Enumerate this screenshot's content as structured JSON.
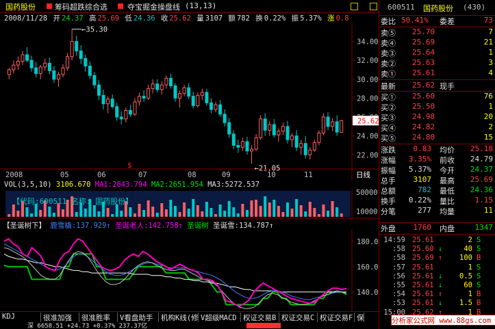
{
  "header": {
    "stock_name": "国药股份",
    "indicator1": "筹码超跌综合选",
    "indicator2": "夺宝掘金操盘线",
    "indicator2_params": "(13,13)"
  },
  "info": {
    "date": "2008/11/28",
    "open_label": "开",
    "open": "24.37",
    "high_label": "高",
    "high": "25.69",
    "low_label": "低",
    "low": "24.36",
    "close_label": "收",
    "close": "25.62",
    "vol_label": "量",
    "vol": "3107",
    "amt_label": "额",
    "amt": "782",
    "turnover_label": "换",
    "turnover": "0.22%",
    "amp_label": "振",
    "amp": "5.37%",
    "chg_label": "涨",
    "chg": "0.8"
  },
  "main_chart": {
    "y_ticks": [
      "34.00",
      "32.00",
      "30.00",
      "28.00",
      "26.00",
      "24.00",
      "22.00"
    ],
    "current_price": "25.62",
    "max_label": "35.30",
    "min_label": "21.05",
    "x_labels": [
      "2008",
      "05",
      "06",
      "07",
      "08",
      "09",
      "10",
      "11"
    ],
    "period": "日线",
    "marker": "$",
    "candles": [
      [
        30.5,
        31.2,
        30.0,
        31.0
      ],
      [
        31.0,
        32.0,
        30.6,
        31.5
      ],
      [
        31.5,
        32.4,
        31.0,
        31.9
      ],
      [
        31.9,
        33.0,
        31.5,
        32.6
      ],
      [
        32.6,
        33.4,
        31.8,
        32.0
      ],
      [
        32.0,
        32.5,
        30.8,
        31.2
      ],
      [
        31.2,
        31.8,
        30.2,
        30.6
      ],
      [
        30.6,
        31.5,
        30.0,
        31.3
      ],
      [
        31.3,
        32.2,
        30.9,
        31.7
      ],
      [
        31.7,
        32.3,
        30.5,
        30.9
      ],
      [
        30.9,
        31.4,
        29.6,
        30.0
      ],
      [
        30.0,
        30.8,
        29.2,
        30.5
      ],
      [
        30.5,
        31.6,
        30.2,
        31.2
      ],
      [
        31.2,
        32.8,
        30.9,
        32.4
      ],
      [
        32.4,
        35.3,
        32.0,
        34.0
      ],
      [
        34.0,
        34.6,
        32.5,
        33.0
      ],
      [
        33.0,
        33.6,
        31.6,
        32.2
      ],
      [
        32.2,
        32.6,
        30.8,
        31.4
      ],
      [
        31.4,
        31.9,
        30.0,
        30.4
      ],
      [
        30.4,
        30.8,
        29.0,
        29.4
      ],
      [
        29.4,
        29.9,
        27.8,
        28.3
      ],
      [
        28.3,
        28.9,
        26.8,
        27.4
      ],
      [
        27.4,
        28.2,
        26.4,
        27.9
      ],
      [
        27.9,
        28.4,
        26.9,
        27.1
      ],
      [
        27.1,
        27.5,
        25.6,
        26.0
      ],
      [
        26.0,
        26.6,
        25.2,
        25.8
      ],
      [
        25.8,
        27.0,
        25.4,
        26.7
      ],
      [
        26.7,
        27.3,
        26.0,
        26.3
      ],
      [
        26.3,
        28.0,
        26.1,
        27.6
      ],
      [
        27.6,
        28.6,
        27.2,
        28.2
      ],
      [
        28.2,
        28.8,
        27.6,
        28.0
      ],
      [
        28.0,
        29.4,
        27.8,
        29.0
      ],
      [
        29.0,
        30.0,
        28.5,
        29.5
      ],
      [
        29.5,
        30.0,
        28.6,
        28.9
      ],
      [
        28.9,
        29.8,
        28.4,
        29.4
      ],
      [
        29.4,
        30.4,
        29.0,
        30.1
      ],
      [
        30.1,
        30.6,
        29.0,
        29.3
      ],
      [
        29.3,
        29.6,
        27.6,
        28.0
      ],
      [
        28.0,
        28.8,
        27.0,
        28.5
      ],
      [
        28.5,
        29.4,
        28.2,
        29.1
      ],
      [
        29.1,
        29.6,
        27.9,
        28.2
      ],
      [
        28.2,
        28.7,
        26.9,
        27.2
      ],
      [
        27.2,
        28.6,
        27.0,
        28.3
      ],
      [
        28.3,
        29.0,
        27.8,
        28.6
      ],
      [
        28.6,
        29.0,
        27.2,
        27.5
      ],
      [
        27.5,
        28.0,
        26.4,
        26.8
      ],
      [
        26.8,
        27.6,
        26.5,
        27.3
      ],
      [
        27.3,
        27.8,
        26.0,
        26.3
      ],
      [
        26.3,
        26.8,
        25.0,
        25.4
      ],
      [
        25.4,
        25.9,
        23.8,
        24.2
      ],
      [
        24.2,
        24.6,
        22.6,
        23.0
      ],
      [
        23.0,
        23.6,
        22.2,
        22.8
      ],
      [
        22.8,
        23.8,
        22.4,
        23.4
      ],
      [
        23.4,
        23.9,
        22.0,
        22.4
      ],
      [
        22.4,
        23.0,
        21.05,
        22.6
      ],
      [
        22.6,
        24.2,
        22.4,
        23.8
      ],
      [
        23.8,
        26.2,
        23.6,
        25.8
      ],
      [
        25.8,
        26.4,
        24.0,
        24.6
      ],
      [
        24.6,
        25.6,
        24.0,
        25.2
      ],
      [
        25.2,
        25.8,
        23.8,
        24.1
      ],
      [
        24.1,
        24.8,
        23.4,
        24.5
      ],
      [
        24.5,
        25.4,
        24.1,
        25.0
      ],
      [
        25.0,
        25.6,
        23.2,
        23.6
      ],
      [
        23.6,
        24.3,
        22.8,
        24.0
      ],
      [
        24.0,
        24.6,
        22.4,
        22.8
      ],
      [
        22.8,
        23.6,
        22.0,
        23.2
      ],
      [
        23.2,
        24.0,
        21.6,
        22.0
      ],
      [
        22.0,
        22.8,
        21.5,
        22.5
      ],
      [
        22.5,
        23.6,
        22.3,
        23.3
      ],
      [
        23.3,
        24.6,
        23.0,
        24.3
      ],
      [
        24.3,
        26.4,
        24.1,
        26.0
      ],
      [
        26.0,
        26.5,
        24.6,
        25.0
      ],
      [
        25.0,
        25.9,
        24.5,
        25.5
      ],
      [
        25.5,
        26.2,
        24.0,
        24.4
      ],
      [
        24.37,
        25.69,
        24.36,
        25.62
      ]
    ]
  },
  "volume_pane": {
    "label": "VOL(3,5,10)",
    "vol": "3106.670",
    "ma1_label": "MA1:",
    "ma1": "2843.794",
    "ma2_label": "MA2:",
    "ma2": "2651.954",
    "ma3_label": "MA3:",
    "ma3": "5272.537",
    "y_ticks": [
      "50000",
      "10000"
    ],
    "code_label": "【代码:600511  名称: 国药股份】"
  },
  "indicator_pane": {
    "name": "【圣诞树下】",
    "line1_label": "鹿雪橇:",
    "line1": "137.929",
    "line2_label": "圣诞老人:",
    "line2": "142.758",
    "line3_label": "圣诞树",
    "line3": "",
    "line4_label": "圣诞雪:",
    "line4": "134.787",
    "y_ticks": [
      "180.00",
      "160.00",
      "140.00"
    ],
    "lines": {
      "snow_white": [
        170,
        168,
        167,
        166,
        166,
        165,
        164,
        163,
        163,
        162,
        161,
        160,
        160,
        159,
        158,
        157,
        157,
        156,
        156,
        155,
        155,
        155,
        155,
        155,
        155,
        155,
        155,
        155,
        154,
        154,
        154,
        154,
        153,
        153,
        153,
        152,
        152,
        151,
        151,
        150,
        150,
        149,
        149,
        148,
        148,
        147,
        147,
        146,
        145,
        144,
        144,
        143,
        142,
        142,
        141,
        141,
        141,
        141,
        141,
        141,
        140,
        140,
        140,
        140,
        140,
        140,
        140,
        140,
        140,
        140,
        140,
        140,
        140,
        140,
        140
      ],
      "blue": [
        178,
        176,
        174,
        172,
        170,
        168,
        166,
        164,
        162,
        160,
        158,
        157,
        158,
        160,
        164,
        168,
        170,
        170,
        168,
        165,
        162,
        159,
        156,
        154,
        153,
        153,
        154,
        156,
        158,
        160,
        162,
        163,
        163,
        162,
        161,
        160,
        159,
        159,
        159,
        159,
        158,
        157,
        156,
        155,
        154,
        153,
        151,
        149,
        146,
        143,
        140,
        138,
        136,
        135,
        135,
        136,
        138,
        140,
        141,
        141,
        140,
        139,
        137,
        136,
        135,
        134,
        134,
        135,
        136,
        137,
        138,
        139,
        140,
        140,
        139
      ],
      "green_white": [
        175,
        174,
        172,
        170,
        168,
        165,
        161,
        157,
        153,
        151,
        150,
        150,
        153,
        159,
        165,
        170,
        172,
        171,
        168,
        163,
        157,
        152,
        148,
        146,
        146,
        147,
        150,
        154,
        158,
        161,
        163,
        164,
        163,
        161,
        159,
        158,
        157,
        157,
        158,
        158,
        156,
        154,
        152,
        150,
        149,
        148,
        145,
        141,
        137,
        133,
        130,
        128,
        127,
        127,
        128,
        131,
        135,
        138,
        139,
        138,
        136,
        134,
        132,
        131,
        130,
        130,
        131,
        133,
        135,
        137,
        138,
        140,
        141,
        140,
        139
      ],
      "tree": [
        161,
        160,
        160,
        160,
        160,
        160,
        150,
        150,
        150,
        150,
        150,
        150,
        150,
        160,
        160,
        170,
        170,
        170,
        170,
        170,
        160,
        160,
        150,
        150,
        150,
        150,
        150,
        150,
        155,
        160,
        160,
        160,
        160,
        160,
        160,
        155,
        155,
        155,
        155,
        155,
        150,
        150,
        150,
        150,
        150,
        145,
        140,
        140,
        130,
        130,
        130,
        130,
        130,
        130,
        130,
        130,
        135,
        135,
        140,
        140,
        135,
        135,
        130,
        130,
        130,
        130,
        130,
        130,
        135,
        135,
        140,
        140,
        140,
        140,
        138
      ],
      "santa": [
        180,
        182,
        178,
        176,
        170,
        168,
        175,
        172,
        168,
        160,
        158,
        157,
        165,
        170,
        172,
        178,
        182,
        180,
        175,
        170,
        165,
        160,
        158,
        157,
        158,
        160,
        165,
        168,
        170,
        168,
        172,
        170,
        167,
        164,
        162,
        160,
        158,
        160,
        162,
        160,
        158,
        157,
        155,
        150,
        150,
        149,
        146,
        140,
        133,
        132,
        130,
        129,
        131,
        134,
        140,
        144,
        147,
        145,
        143,
        141,
        139,
        137,
        135,
        134,
        133,
        132,
        131,
        132,
        135,
        138,
        141,
        143,
        143,
        142,
        142.7
      ]
    }
  },
  "quote": {
    "code": "600511",
    "name": "国药股份",
    "count": "(430)",
    "weibi_label": "委比",
    "weibi": "50.41%",
    "weicha_label": "委差",
    "weicha": "73",
    "sells": [
      {
        "label": "卖⑤",
        "price": "25.70",
        "vol": "7"
      },
      {
        "label": "卖④",
        "price": "25.69",
        "vol": "21"
      },
      {
        "label": "卖③",
        "price": "25.64",
        "vol": "1"
      },
      {
        "label": "卖②",
        "price": "25.63",
        "vol": "3"
      },
      {
        "label": "卖①",
        "price": "25.61",
        "vol": "4"
      }
    ],
    "last_label": "最新",
    "last": "25.62",
    "xianshou_label": "现手",
    "xianshou": "",
    "buys": [
      {
        "label": "买①",
        "price": "25.60",
        "vol": "76"
      },
      {
        "label": "买②",
        "price": "25.50",
        "vol": "1"
      },
      {
        "label": "买③",
        "price": "24.98",
        "vol": "20"
      },
      {
        "label": "买④",
        "price": "24.82",
        "vol": "2"
      },
      {
        "label": "买⑤",
        "price": "24.80",
        "vol": "15"
      }
    ],
    "stats": [
      {
        "l1": "涨跌",
        "v1": "0.83",
        "l2": "均价",
        "v2": "25.18",
        "c1": "#ff4040",
        "c2": "#ff4040"
      },
      {
        "l1": "涨幅",
        "v1": "3.35%",
        "l2": "前收",
        "v2": "24.79",
        "c1": "#ff4040",
        "c2": "#e0e0e0"
      },
      {
        "l1": "振幅",
        "v1": "5.37%",
        "l2": "今开",
        "v2": "24.37",
        "c1": "#e0e0e0",
        "c2": "#00e000"
      },
      {
        "l1": "总手",
        "v1": "3107",
        "l2": "最高",
        "v2": "25.69",
        "c1": "#ffff00",
        "c2": "#ff4040"
      },
      {
        "l1": "总额",
        "v1": "782",
        "l2": "最低",
        "v2": "24.36",
        "c1": "#00c8c8",
        "c2": "#00e000"
      },
      {
        "l1": "换手",
        "v1": "0.22%",
        "l2": "量比",
        "v2": "1.15",
        "c1": "#e0e0e0",
        "c2": "#ff4040"
      },
      {
        "l1": "分笔",
        "v1": "277",
        "l2": "均量",
        "v2": "11",
        "c1": "#e0e0e0",
        "c2": "#ffff00"
      }
    ],
    "waipan_label": "外盘",
    "waipan": "1760",
    "neipan_label": "内盘",
    "neipan": "1347",
    "ticks": [
      {
        "t": "14:59",
        "p": "25.61",
        "a": "",
        "v": "2",
        "s": "S",
        "pc": "#ff4040",
        "ac": "#ffff00",
        "sc": "#00e000"
      },
      {
        "t": ":58",
        "p": "25.60",
        "a": "↓",
        "v": "40",
        "s": "S",
        "pc": "#ff4040",
        "ac": "#00e000",
        "sc": "#00e000"
      },
      {
        "t": ":58",
        "p": "25.69",
        "a": "↑",
        "v": "100",
        "s": "B",
        "pc": "#ff4040",
        "ac": "#ff4040",
        "sc": "#ff4040"
      },
      {
        "t": ":57",
        "p": "25.61",
        "a": "",
        "v": "1",
        "s": "S",
        "pc": "#ff4040",
        "ac": "#ffff00",
        "sc": "#00e000"
      },
      {
        "t": ":56",
        "p": "25.61",
        "a": "↓",
        "v": "0.5",
        "s": "S",
        "pc": "#ff4040",
        "ac": "#00e000",
        "sc": "#00e000"
      },
      {
        "t": ":55",
        "p": "25.61",
        "a": "↓",
        "v": "60",
        "s": "S",
        "pc": "#ff4040",
        "ac": "#00e000",
        "sc": "#00e000"
      },
      {
        "t": ":54",
        "p": "25.61",
        "a": "↑",
        "v": "1",
        "s": "B",
        "pc": "#ff4040",
        "ac": "#ff4040",
        "sc": "#ff4040"
      },
      {
        "t": ":53",
        "p": "25.61",
        "a": "↓",
        "v": "1.5",
        "s": "B",
        "pc": "#ff4040",
        "ac": "#00e000",
        "sc": "#ff4040"
      },
      {
        "t": "15:00",
        "p": "25.62",
        "a": "↑",
        "v": "1",
        "s": "B",
        "pc": "#ff4040",
        "ac": "#ff4040",
        "sc": "#ff4040"
      }
    ]
  },
  "tabs": [
    "KDJ",
    "很准加强",
    "很准胜率",
    "V看盘助手",
    "机构K线(修",
    "V超级MACD",
    "权证交易B",
    "权证交易C",
    "权证交易F",
    "保"
  ],
  "status": "深 6658.51 +24.73 +0.37% 237.37亿",
  "watermark": "分析家公式网 www.88gs.com",
  "colors": {
    "up": "#ff6060",
    "down": "#00c8c8",
    "bg": "#000000",
    "grid": "#800000"
  }
}
